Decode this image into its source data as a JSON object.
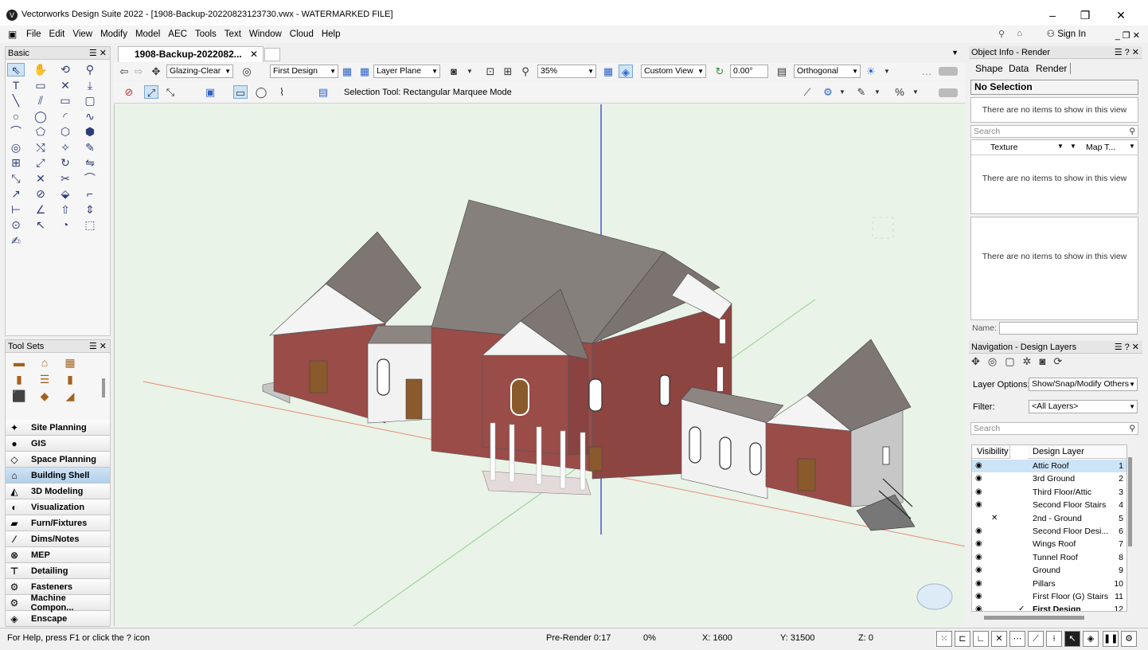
{
  "window": {
    "title": "Vectorworks Design Suite 2022 - [1908-Backup-20220823123730.vwx - WATERMARKED FILE]",
    "controls": [
      "–",
      "❐",
      "✕"
    ]
  },
  "menu": {
    "items": [
      "File",
      "Edit",
      "View",
      "Modify",
      "Model",
      "AEC",
      "Tools",
      "Text",
      "Window",
      "Cloud",
      "Help"
    ],
    "sign_in": "Sign In"
  },
  "basic_palette": {
    "title": "Basic",
    "tools": [
      "selection-tool-icon",
      "pan-tool-icon",
      "flyover-tool-icon",
      "zoom-tool-icon",
      "text-tool-icon",
      "callout-tool-icon",
      "locus-tool-icon",
      "drop-tool-icon",
      "line-tool-icon",
      "double-line-tool-icon",
      "rectangle-tool-icon",
      "rounded-rectangle-tool-icon",
      "circle-tool-icon",
      "oval-tool-icon",
      "arc-tool-icon",
      "freehand-tool-icon",
      "polyline-tool-icon",
      "polygon-tool-icon",
      "double-polygon-tool-icon",
      "regular-polygon-tool-icon",
      "spiral-tool-icon",
      "attribute-mapping-tool-icon",
      "wand-tool-icon",
      "eyedropper-tool-icon",
      "move-tool-icon",
      "offset-tool-icon",
      "rotate-tool-icon",
      "mirror-tool-icon",
      "reshape-tool-icon",
      "trim-tool-icon",
      "split-tool-icon",
      "fillet-tool-icon",
      "connect-tool-icon",
      "clip-tool-icon",
      "bucket-tool-icon",
      "chamfer-tool-icon",
      "dimension-tool-icon",
      "angle-dimension-tool-icon",
      "extrude-tool-icon",
      "push-pull-tool-icon",
      "circle-dimension-tool-icon",
      "3d-pointer-tool-icon",
      "protractor-tool-icon",
      "model-tool-icon",
      "paint-tool-icon"
    ]
  },
  "tool_sets": {
    "title": "Tool Sets",
    "grid_icons": [
      "walls-icon",
      "doors-icon",
      "windows-icon",
      "stairs-icon",
      "columns-icon",
      "roof-icon",
      "framing-icon",
      "slabs-icon",
      "railings-icon"
    ],
    "items": [
      {
        "label": "Site Planning",
        "icon": "site-planning-icon"
      },
      {
        "label": "GIS",
        "icon": "gis-icon"
      },
      {
        "label": "Space Planning",
        "icon": "space-planning-icon"
      },
      {
        "label": "Building Shell",
        "icon": "building-shell-icon",
        "active": true
      },
      {
        "label": "3D Modeling",
        "icon": "3d-modeling-icon"
      },
      {
        "label": "Visualization",
        "icon": "visualization-icon"
      },
      {
        "label": "Furn/Fixtures",
        "icon": "furniture-icon"
      },
      {
        "label": "Dims/Notes",
        "icon": "dims-notes-icon"
      },
      {
        "label": "MEP",
        "icon": "mep-icon"
      },
      {
        "label": "Detailing",
        "icon": "detailing-icon"
      },
      {
        "label": "Fasteners",
        "icon": "fasteners-icon"
      },
      {
        "label": "Machine Compon...",
        "icon": "machine-components-icon"
      },
      {
        "label": "Enscape",
        "icon": "enscape-icon"
      }
    ]
  },
  "document": {
    "tab_label": "1908-Backup-2022082...",
    "class_dropdown": "Glazing-Clear",
    "layer_dropdown": "First Design",
    "plane_dropdown": "Layer Plane",
    "zoom": "35%",
    "view_dropdown": "Custom View",
    "rotation": "0.00°",
    "projection_dropdown": "Orthogonal",
    "tool_mode_text": "Selection Tool: Rectangular Marquee Mode"
  },
  "object_info": {
    "title": "Object Info - Render",
    "tabs": [
      "Shape",
      "Data",
      "Render"
    ],
    "selection": "No Selection",
    "empty_message_1": "There are no items to show in this view",
    "search_placeholder": "Search",
    "texture_col": "Texture",
    "map_col": "Map T...",
    "empty_message_2": "There are no items to show in this view",
    "empty_message_3": "There are no items to show in this view",
    "name_label": "Name:"
  },
  "navigation": {
    "title": "Navigation - Design Layers",
    "layer_options_label": "Layer Options:",
    "layer_options_value": "Show/Snap/Modify Others",
    "filter_label": "Filter:",
    "filter_value": "<All Layers>",
    "search_placeholder": "Search",
    "col_visibility": "Visibility",
    "col_design_layer": "Design Layer",
    "layers": [
      {
        "name": "Attic Roof",
        "num": "1",
        "vis": "eye",
        "selected": true
      },
      {
        "name": "3rd Ground",
        "num": "2",
        "vis": "eye"
      },
      {
        "name": "Third Floor/Attic",
        "num": "3",
        "vis": "eye"
      },
      {
        "name": "Second Floor Stairs",
        "num": "4",
        "vis": "eye"
      },
      {
        "name": "2nd - Ground",
        "num": "5",
        "vis": "x"
      },
      {
        "name": "Second Floor Desi...",
        "num": "6",
        "vis": "eye"
      },
      {
        "name": "Wings Roof",
        "num": "7",
        "vis": "eye"
      },
      {
        "name": "Tunnel Roof",
        "num": "8",
        "vis": "eye"
      },
      {
        "name": "Ground",
        "num": "9",
        "vis": "eye"
      },
      {
        "name": "Pillars",
        "num": "10",
        "vis": "eye"
      },
      {
        "name": "First Floor (G) Stairs",
        "num": "11",
        "vis": "eye"
      },
      {
        "name": "First Design",
        "num": "12",
        "vis": "eye",
        "active": true
      }
    ]
  },
  "status": {
    "help_text": "For Help, press F1 or click the ? icon",
    "prerender": "Pre-Render 0:17",
    "percent": "0%",
    "x": "X: 1600",
    "y": "Y: 31500",
    "z": "Z: 0"
  },
  "colors": {
    "canvas_bg": "#eaf3e7",
    "brick": "#9a4c48",
    "roof": "#7d7673",
    "selection_blue": "#cde4f7"
  }
}
